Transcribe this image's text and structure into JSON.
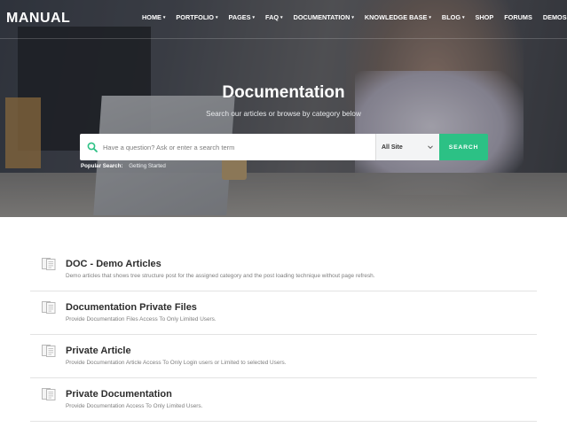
{
  "brand": {
    "logo": "MANUAL"
  },
  "nav": {
    "items": [
      {
        "label": "HOME",
        "has_caret": true
      },
      {
        "label": "PORTFOLIO",
        "has_caret": true
      },
      {
        "label": "PAGES",
        "has_caret": true
      },
      {
        "label": "FAQ",
        "has_caret": true
      },
      {
        "label": "DOCUMENTATION",
        "has_caret": true
      },
      {
        "label": "KNOWLEDGE BASE",
        "has_caret": true
      },
      {
        "label": "BLOG",
        "has_caret": true
      },
      {
        "label": "SHOP",
        "has_caret": false
      },
      {
        "label": "FORUMS",
        "has_caret": false
      },
      {
        "label": "DEMOS",
        "has_caret": false
      }
    ],
    "caret_glyph": "▾"
  },
  "hero": {
    "title": "Documentation",
    "subtitle": "Search our articles or browse by category below"
  },
  "search": {
    "placeholder": "Have a question? Ask or enter a search term",
    "value": "",
    "scope_selected": "All Site",
    "button_label": "SEARCH",
    "popular_label": "Popular Search:",
    "popular_terms": [
      "Getting Started"
    ]
  },
  "articles": [
    {
      "title": "DOC - Demo Articles",
      "description": "Demo articles that shows tree structure post for the assigned category and the post loading technique without page refresh."
    },
    {
      "title": "Documentation Private Files",
      "description": "Provide Documentation Files Access To Only Limited Users."
    },
    {
      "title": "Private Article",
      "description": "Provide Documentation Article Access To Only Login users or Limited to selected Users."
    },
    {
      "title": "Private Documentation",
      "description": "Provide Documentation Access To Only Limited Users."
    }
  ],
  "colors": {
    "accent": "#2cc185",
    "title_text": "#2d2d2d",
    "desc_text": "#7e7e7e",
    "divider": "#e3e3e3"
  },
  "icons": {
    "search": "search-icon",
    "scope_dropdown": "chevron-down-icon",
    "article": "document-icon"
  }
}
